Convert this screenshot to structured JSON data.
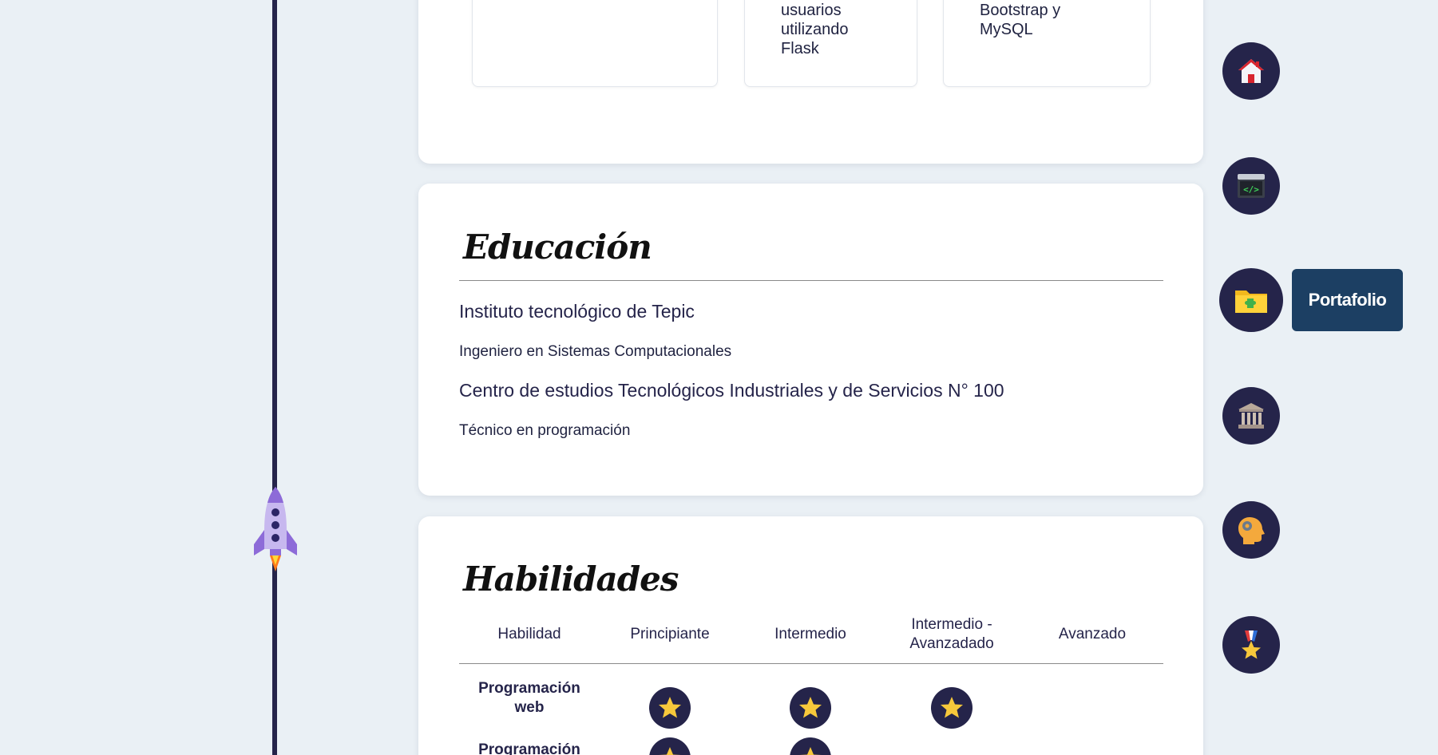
{
  "projects": {
    "card2_desc": "usuarios\nutilizando\nFlask",
    "card3_desc": "Blog con Laravel,\nBootstrap y\nMySQL"
  },
  "education": {
    "title": "Educación",
    "entries": [
      {
        "school": "Instituto tecnológico de Tepic",
        "degree": "Ingeniero en Sistemas Computacionales"
      },
      {
        "school": "Centro de estudios Tecnológicos Industriales y de Servicios N° 100",
        "degree": "Técnico en programación"
      }
    ]
  },
  "skills": {
    "title": "Habilidades",
    "headers": [
      "Habilidad",
      "Principiante",
      "Intermedio",
      "Intermedio -\nAvanzadado",
      "Avanzado"
    ],
    "rows": [
      {
        "name": "Programación\nweb",
        "level": 3
      },
      {
        "name": "Programación",
        "level": 2
      }
    ]
  },
  "nav": {
    "items": [
      {
        "icon": "house-icon"
      },
      {
        "icon": "code-window-icon"
      },
      {
        "icon": "folder-puzzle-icon",
        "tooltip": "Portafolio"
      },
      {
        "icon": "institution-icon"
      },
      {
        "icon": "head-gear-icon"
      },
      {
        "icon": "medal-icon"
      }
    ]
  },
  "colors": {
    "navy": "#25244a",
    "tooltip": "#1c3f63",
    "star": "#f7c83b"
  }
}
